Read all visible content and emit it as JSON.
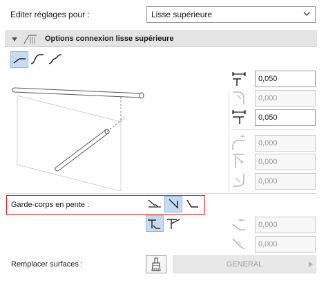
{
  "header": {
    "edit_label": "Editer réglages pour :",
    "dropdown_value": "Lisse supérieure"
  },
  "section": {
    "title": "Options connexion lisse supérieure"
  },
  "fields": [
    {
      "value": "0,050",
      "enabled": true
    },
    {
      "value": "0,000",
      "enabled": false
    },
    {
      "value": "0,050",
      "enabled": true
    },
    {
      "value": "0,000",
      "enabled": false
    },
    {
      "value": "0,000",
      "enabled": false
    },
    {
      "value": "0,000",
      "enabled": false
    }
  ],
  "garde_corps": {
    "label": "Garde-corps en pente :",
    "fields": [
      {
        "value": "0,000",
        "enabled": false
      },
      {
        "value": "0,000",
        "enabled": false
      }
    ]
  },
  "surfaces": {
    "label": "Remplacer surfaces :",
    "button_label": "GENERAL"
  },
  "colors": {
    "active_button": "#c4dcf2",
    "highlight_box": "#e02020"
  }
}
